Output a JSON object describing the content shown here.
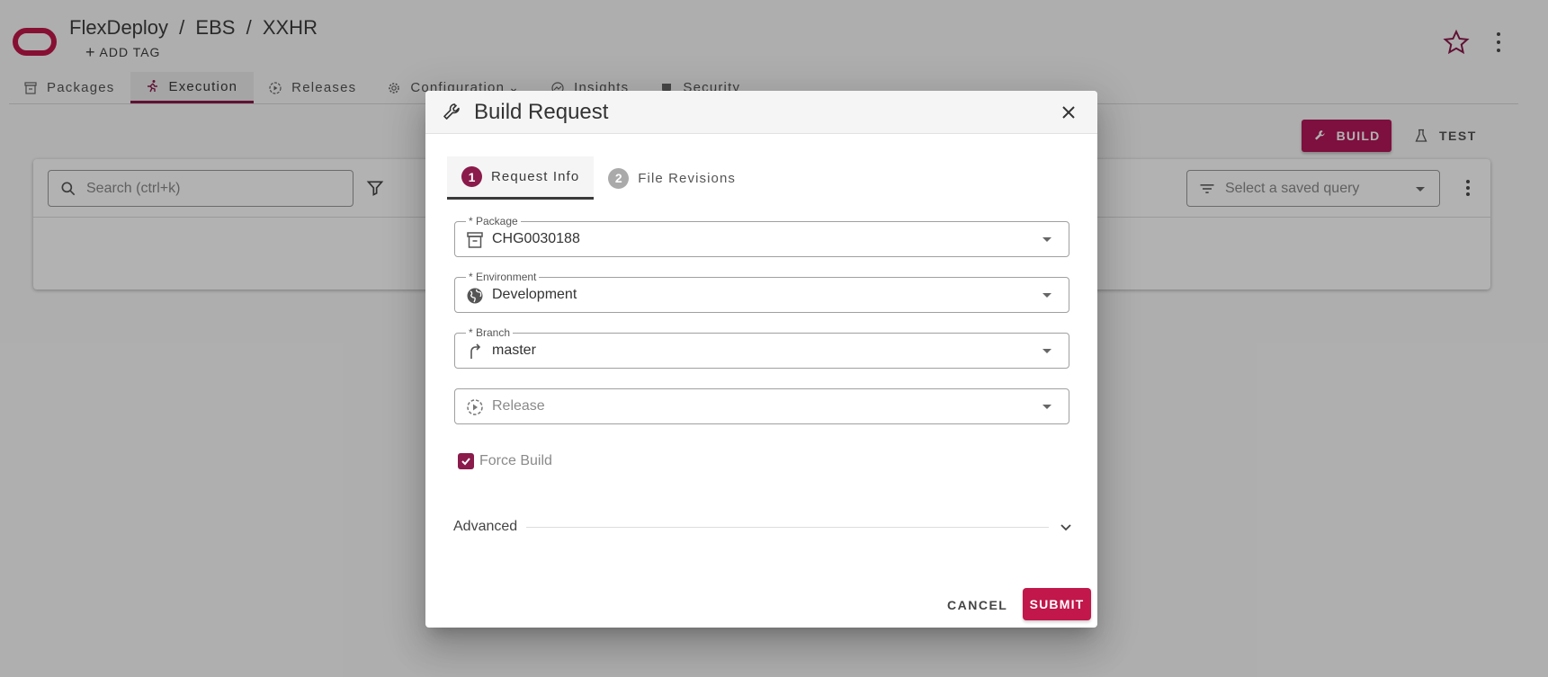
{
  "header": {
    "breadcrumb": [
      "FlexDeploy",
      "/",
      "EBS",
      "/",
      "XXHR"
    ],
    "add_tag_label": "ADD TAG",
    "add_tag_prefix": "+"
  },
  "tabs": [
    {
      "label": "Packages",
      "icon": "package-icon",
      "active": false
    },
    {
      "label": "Execution",
      "icon": "run-icon",
      "active": true
    },
    {
      "label": "Releases",
      "icon": "release-icon",
      "active": false
    },
    {
      "label": "Configuration",
      "icon": "gear-icon",
      "active": false,
      "has_dropdown": true
    },
    {
      "label": "Insights",
      "icon": "insights-icon",
      "active": false
    },
    {
      "label": "Security",
      "icon": "security-icon",
      "active": false
    }
  ],
  "toolbar": {
    "build_label": "BUILD",
    "test_label": "TEST"
  },
  "list": {
    "search_placeholder": "Search (ctrl+k)",
    "saved_query_placeholder": "Select a saved query"
  },
  "dialog": {
    "title": "Build Request",
    "steps": [
      {
        "number": "1",
        "label": "Request Info",
        "active": true
      },
      {
        "number": "2",
        "label": "File Revisions",
        "active": false
      }
    ],
    "fields": {
      "package": {
        "label": "* Package",
        "value": "CHG0030188"
      },
      "environment": {
        "label": "* Environment",
        "value": "Development"
      },
      "branch": {
        "label": "* Branch",
        "value": "master"
      },
      "release": {
        "label": "",
        "placeholder": "Release",
        "value": ""
      }
    },
    "force_build": {
      "label": "Force Build",
      "checked": true
    },
    "advanced_label": "Advanced",
    "cancel_label": "CANCEL",
    "submit_label": "SUBMIT"
  },
  "colors": {
    "brand": "#c1174a",
    "accent": "#8a1b4b",
    "build_button": "#b3175a"
  }
}
